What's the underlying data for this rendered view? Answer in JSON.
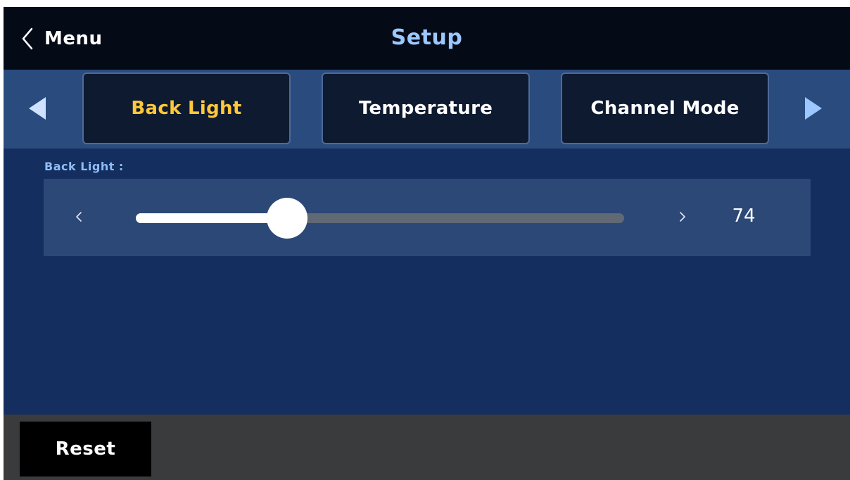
{
  "header": {
    "back_label": "Menu",
    "back_icon": "chevron-left-icon",
    "title": "Setup"
  },
  "tabs": {
    "prev_icon": "triangle-left-icon",
    "next_icon": "triangle-right-icon",
    "items": [
      {
        "label": "Back Light",
        "active": true
      },
      {
        "label": "Temperature",
        "active": false
      },
      {
        "label": "Channel Mode",
        "active": false
      }
    ]
  },
  "backlight": {
    "label": "Back Light :",
    "value": "74",
    "slider_fraction": 0.31,
    "decrement_icon": "chevron-left-icon",
    "increment_icon": "chevron-right-icon"
  },
  "footer": {
    "reset_label": "Reset"
  },
  "colors": {
    "background": "#132e5f",
    "header": "#050a17",
    "title": "#9cc7ff",
    "active_tab_text": "#ffc83a",
    "tab_strip": "#2a4b7e",
    "slider_panel": "#2c4877",
    "footer": "#3a3b3d"
  }
}
